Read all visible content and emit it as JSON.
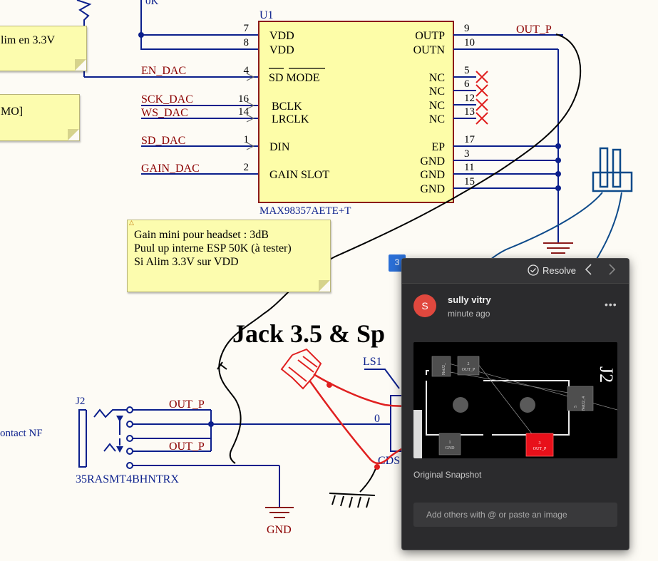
{
  "colors": {
    "wire": "#0b1f8c",
    "net_label": "#8b0000",
    "ref": "#0b1f8c",
    "chip_fill": "#fdfda8",
    "chip_border": "#8b1a1a",
    "no_connect": "#e02020",
    "sketch_black": "#000000",
    "sketch_red": "#e02020",
    "sketch_blue": "#0d4a8a",
    "panel_bg": "#2b2b2d",
    "avatar": "#e0483e"
  },
  "notes": {
    "top_left": "lim en 3.3V",
    "mid_left": "MO]",
    "gain": "Gain mini pour headset : 3dB\nPuul up interne ESP 50K (à tester)\nSi Alim 3.3V sur VDD"
  },
  "resistor_value": "0K",
  "chip": {
    "ref": "U1",
    "part": "MAX98357AETE+T",
    "left_pins": [
      {
        "num": "7",
        "name": "VDD"
      },
      {
        "num": "8",
        "name": "VDD"
      },
      {
        "num": "4",
        "name": "SD MODE"
      },
      {
        "num": "16",
        "name": "BCLK"
      },
      {
        "num": "14",
        "name": "LRCLK"
      },
      {
        "num": "1",
        "name": "DIN"
      },
      {
        "num": "2",
        "name": "GAIN SLOT"
      }
    ],
    "right_pins": [
      {
        "num": "9",
        "name": "OUTP"
      },
      {
        "num": "10",
        "name": "OUTN"
      },
      {
        "num": "5",
        "name": "NC"
      },
      {
        "num": "6",
        "name": "NC"
      },
      {
        "num": "12",
        "name": "NC"
      },
      {
        "num": "13",
        "name": "NC"
      },
      {
        "num": "17",
        "name": "EP"
      },
      {
        "num": "3",
        "name": "GND"
      },
      {
        "num": "11",
        "name": "GND"
      },
      {
        "num": "15",
        "name": "GND"
      }
    ]
  },
  "nets": {
    "out_p_top": "OUT_P",
    "en_dac": "EN_DAC",
    "sck_dac": "SCK_DAC",
    "ws_dac": "WS_DAC",
    "sd_dac": "SD_DAC",
    "gain_dac": "GAIN_DAC",
    "out_p_j2a": "OUT_P",
    "out_p_j2b": "OUT_P",
    "zero": "0",
    "gnd": "GND"
  },
  "section_title": "Jack 3.5 & Sp",
  "jack": {
    "ref": "J2",
    "part": "35RASMT4BHNTRX",
    "contact_label": "ontact NF"
  },
  "speaker": {
    "ref": "LS1",
    "part_fragment": "CDS"
  },
  "comment": {
    "badge": "3",
    "resolve_label": "Resolve",
    "user_initial": "S",
    "user_name": "sully vitry",
    "time": "minute ago",
    "more": "•••",
    "snapshot_label": "Original Snapshot",
    "add_placeholder": "Add others with @ or paste an image",
    "snapshot": {
      "designator": "J2",
      "pads": [
        {
          "num": "",
          "net": "NetJ2_",
          "highlight": false
        },
        {
          "num": "2",
          "net": "OUT_P",
          "highlight": false
        },
        {
          "num": "5",
          "net": "NetJ2_4",
          "highlight": false
        },
        {
          "num": "1",
          "net": "GND",
          "highlight": false
        },
        {
          "num": "3",
          "net": "OUT_P",
          "highlight": true
        }
      ]
    }
  }
}
